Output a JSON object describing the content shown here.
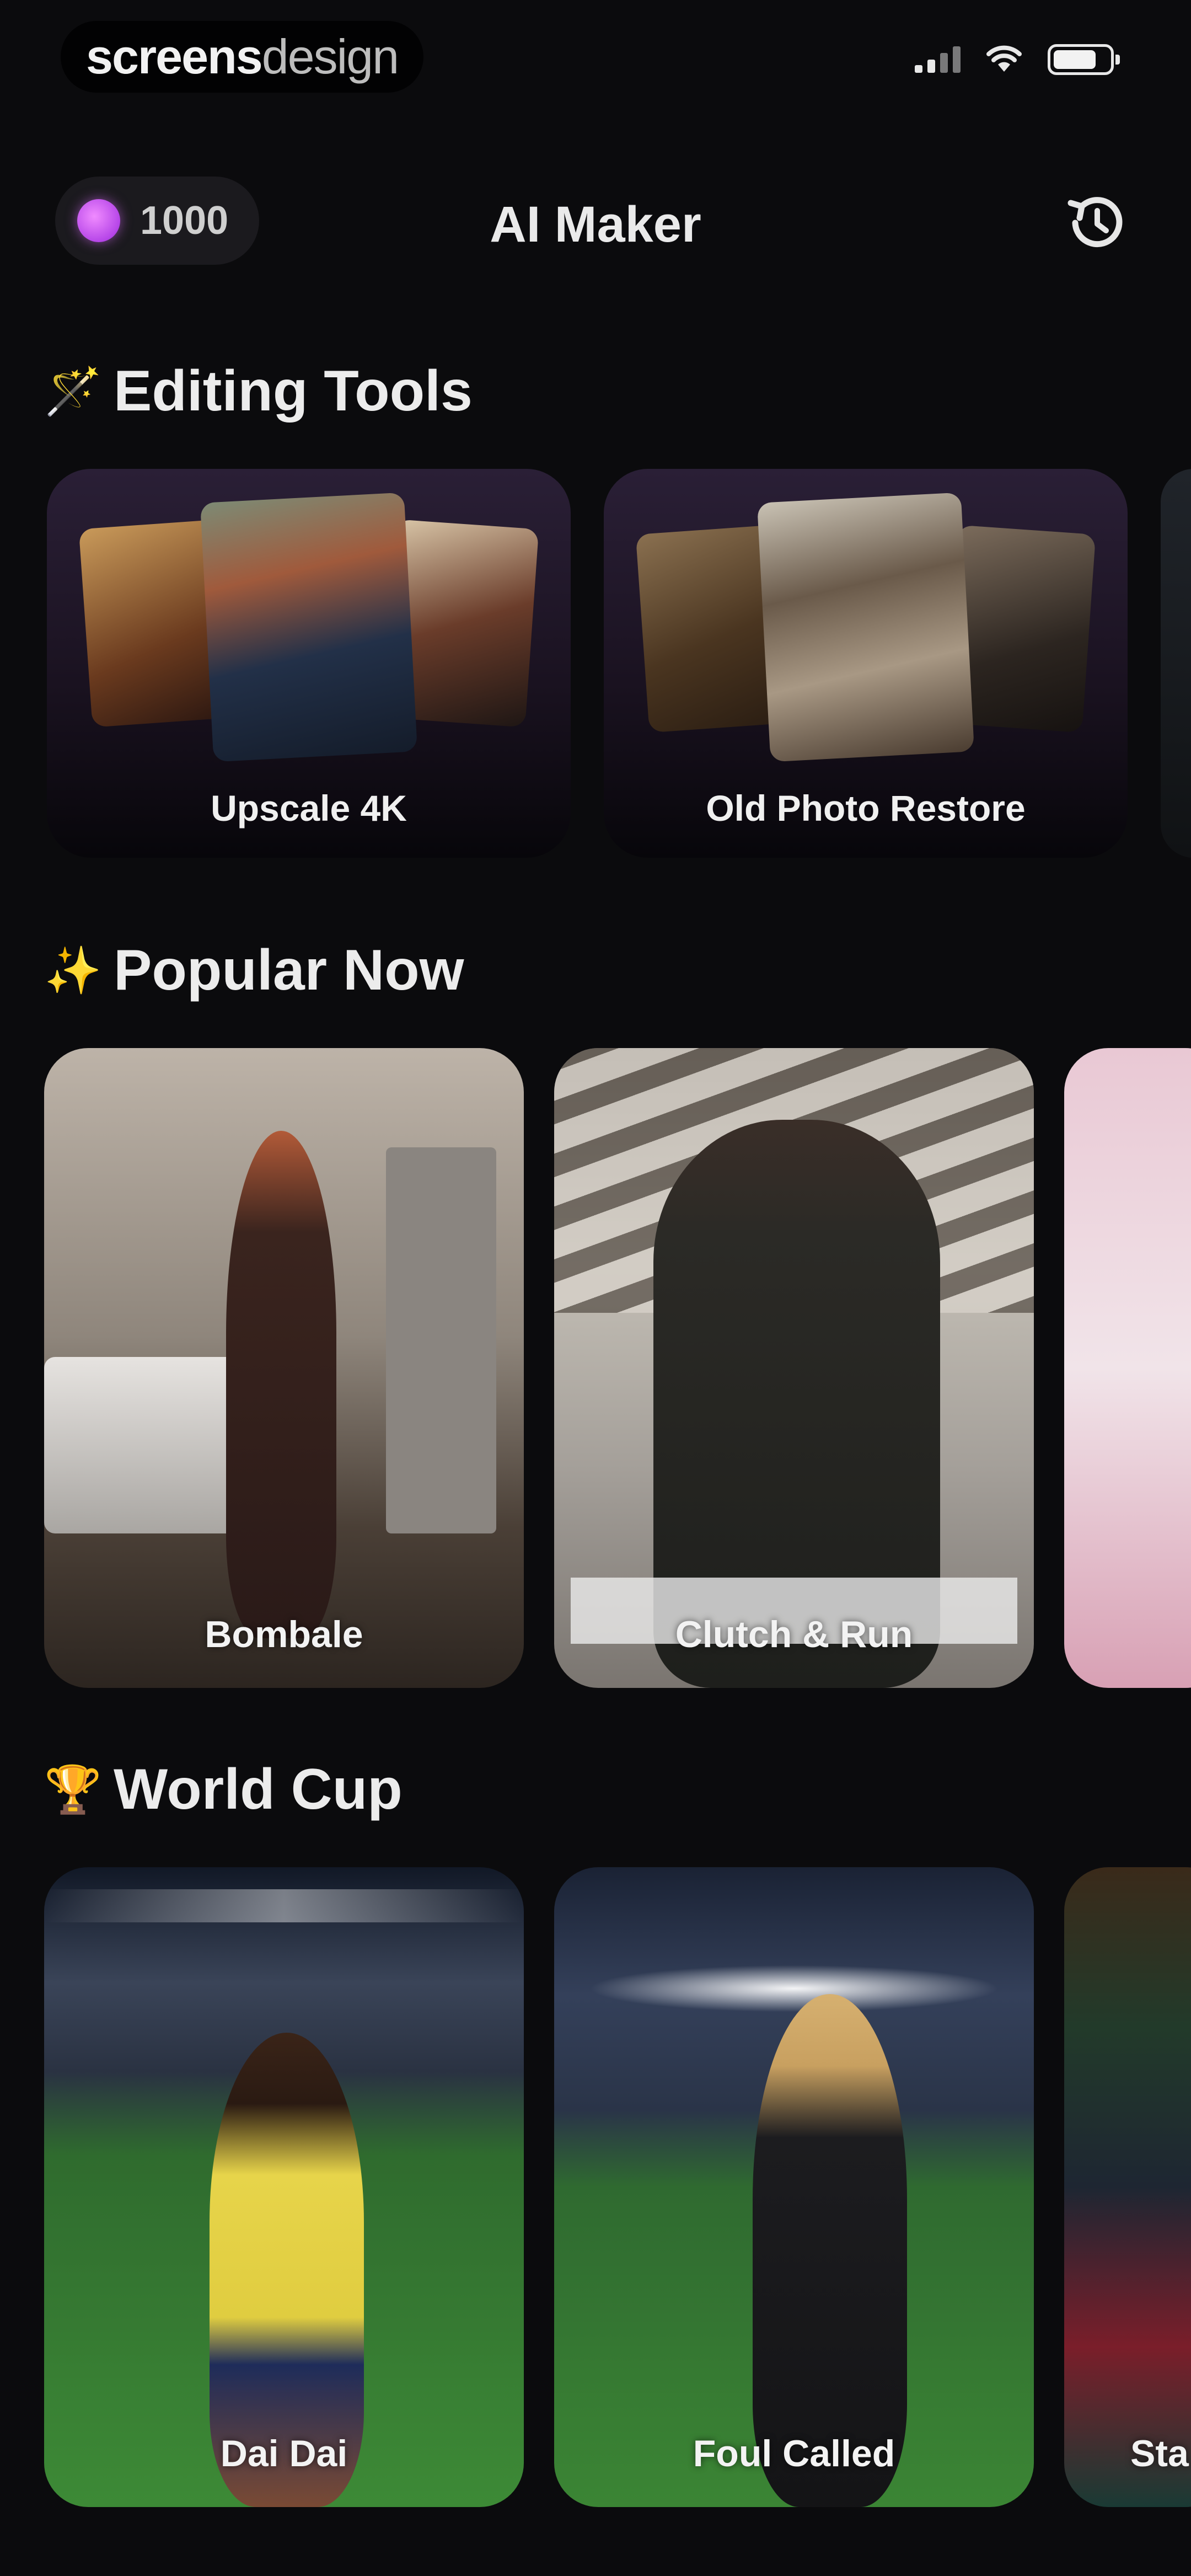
{
  "status_bar": {
    "brand_bold": "screens",
    "brand_light": "design"
  },
  "header": {
    "credits": "1000",
    "title": "AI Maker"
  },
  "sections": {
    "editing_tools": {
      "emoji": "🪄",
      "title": "Editing Tools"
    },
    "popular_now": {
      "emoji": "✨",
      "title": "Popular Now"
    },
    "world_cup": {
      "emoji": "🏆",
      "title": "World Cup"
    }
  },
  "editing_tools": [
    {
      "label": "Upscale 4K"
    },
    {
      "label": "Old Photo Restore"
    }
  ],
  "popular_now": [
    {
      "label": "Bombale"
    },
    {
      "label": "Clutch & Run"
    }
  ],
  "world_cup": [
    {
      "label": "Dai Dai"
    },
    {
      "label": "Foul Called"
    },
    {
      "label": "Sta"
    }
  ],
  "colors": {
    "background": "#0b0b0d",
    "accent": "#c85cf0",
    "card_top": "#2a1f36"
  }
}
